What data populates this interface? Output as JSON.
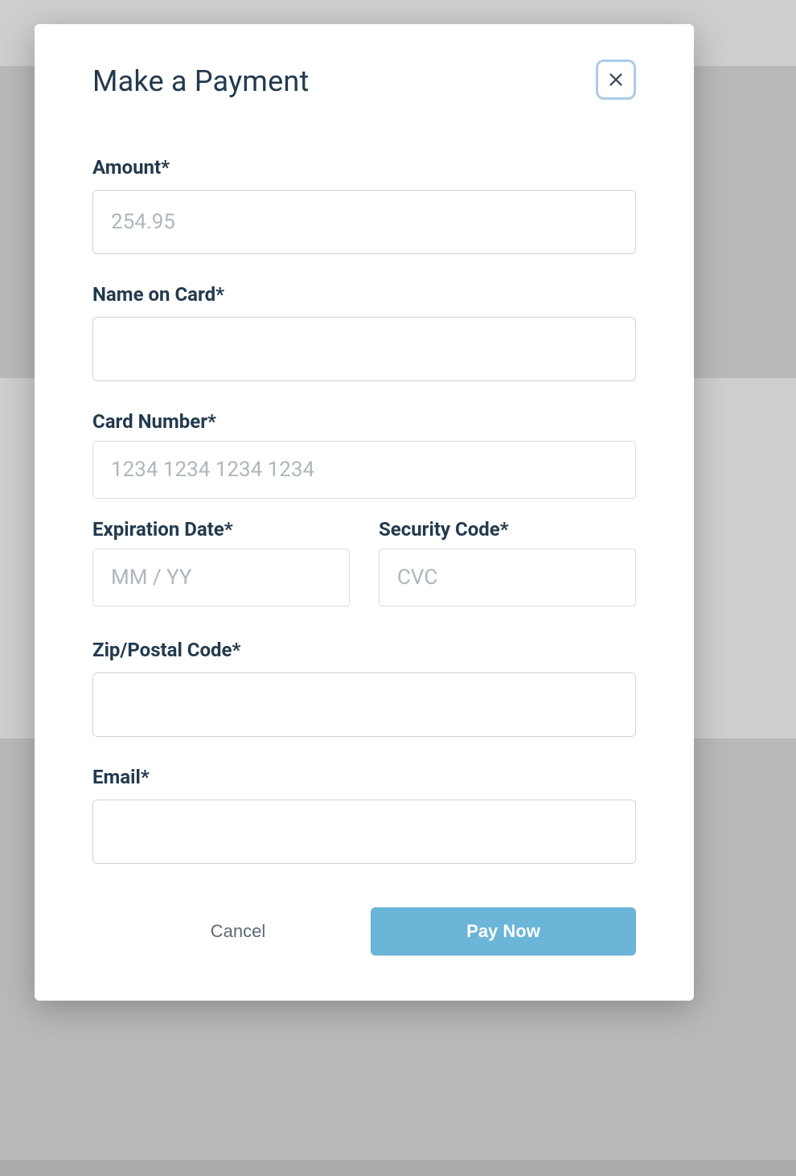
{
  "modal": {
    "title": "Make a Payment",
    "close_aria": "Close"
  },
  "form": {
    "amount": {
      "label": "Amount*",
      "placeholder": "254.95",
      "value": ""
    },
    "name_on_card": {
      "label": "Name on Card*",
      "value": ""
    },
    "card_number": {
      "label": "Card Number*",
      "placeholder": "1234 1234 1234 1234",
      "value": ""
    },
    "expiration": {
      "label": "Expiration Date*",
      "placeholder": "MM / YY",
      "value": ""
    },
    "security_code": {
      "label": "Security Code*",
      "placeholder": "CVC",
      "value": ""
    },
    "zip": {
      "label": "Zip/Postal Code*",
      "value": ""
    },
    "email": {
      "label": "Email*",
      "value": ""
    }
  },
  "actions": {
    "cancel": "Cancel",
    "submit": "Pay Now"
  }
}
